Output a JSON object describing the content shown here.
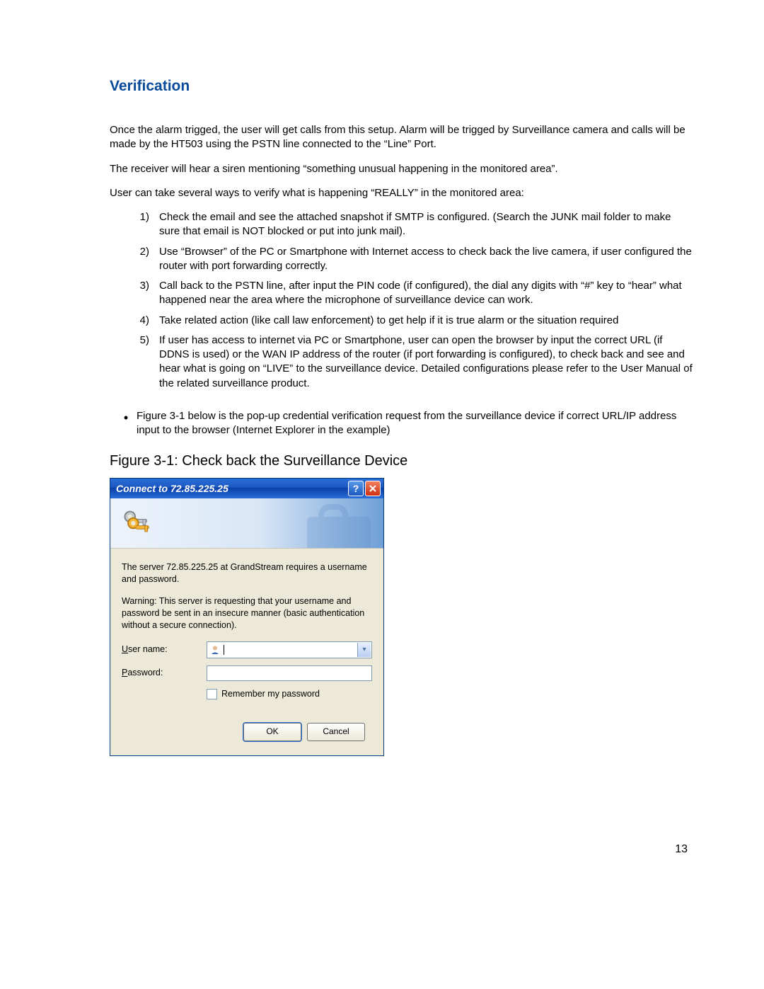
{
  "section_title": "Verification",
  "para1": "Once the alarm trigged, the user will get calls from this setup. Alarm will be trigged by Surveillance camera and calls will be made by the HT503 using the PSTN line connected to the “Line” Port.",
  "para2": "The receiver will hear a siren mentioning “something unusual happening in the monitored area”.",
  "para3": "User can take several ways to verify what is happening “REALLY” in the monitored area:",
  "list": [
    "Check the email and see the attached snapshot if SMTP is configured. (Search the JUNK mail folder to make sure that email is NOT blocked or put into junk mail).",
    "Use “Browser” of the PC or Smartphone with Internet access to check back the live camera, if user configured the router with port forwarding correctly.",
    "Call back to the PSTN line, after input the PIN code (if configured), the dial any digits with “#” key to “hear” what happened near the area where the microphone of surveillance device can work.",
    "Take related action (like call law enforcement) to get help if it is true alarm or the situation required",
    "If user has access to internet via PC or Smartphone, user can open the browser by input the correct URL (if DDNS is used) or the WAN IP address of the router (if port forwarding is configured), to check back and see and hear what is going on “LIVE” to the surveillance device. Detailed configurations please refer to the User Manual of the related surveillance product."
  ],
  "bullet_text": "Figure 3-1 below is the pop-up credential verification request from the surveillance device if correct URL/IP address input to the browser (Internet Explorer in the example)",
  "figure_caption": "Figure 3-1:  Check back the Surveillance Device",
  "dialog": {
    "title": "Connect to 72.85.225.25",
    "msg1": "The server 72.85.225.25 at GrandStream requires a username and password.",
    "msg2": "Warning: This server is requesting that your username and password be sent in an insecure manner (basic authentication without a secure connection).",
    "username_label_pre": "U",
    "username_label_rest": "ser name:",
    "password_label_pre": "P",
    "password_label_rest": "assword:",
    "remember_pre": "R",
    "remember_rest": "emember my password",
    "ok": "OK",
    "cancel": "Cancel"
  },
  "page_number": "13"
}
